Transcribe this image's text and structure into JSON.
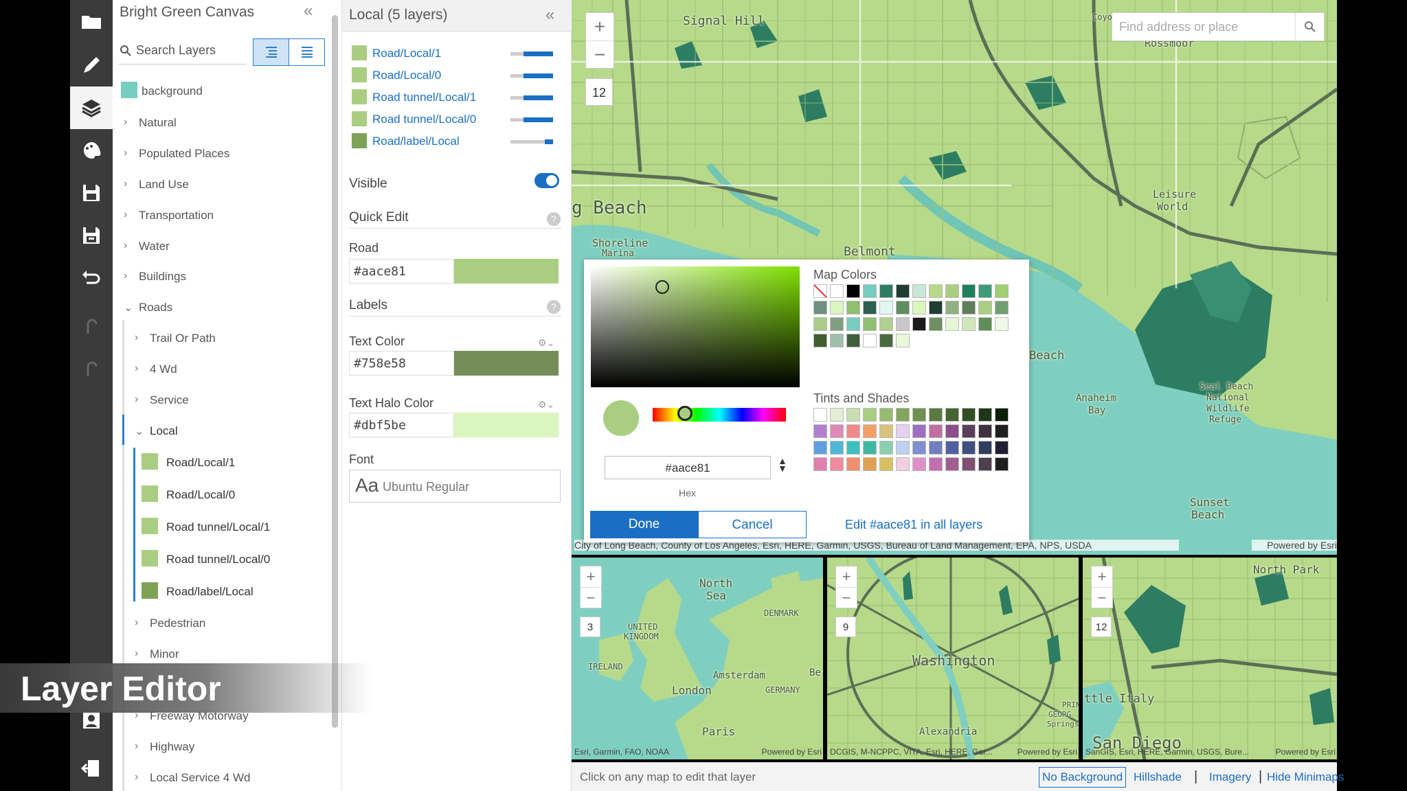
{
  "layers_panel": {
    "title": "Bright Green Canvas",
    "search_label": "Search Layers",
    "background_label": "background",
    "groups": [
      "Natural",
      "Populated Places",
      "Land Use",
      "Transportation",
      "Water",
      "Buildings",
      "Roads"
    ],
    "roads_children": [
      "Trail Or Path",
      "4 Wd",
      "Service",
      "Local"
    ],
    "local_children": [
      "Road/Local/1",
      "Road/Local/0",
      "Road tunnel/Local/1",
      "Road tunnel/Local/0",
      "Road/label/Local"
    ],
    "more_roads": [
      "Pedestrian",
      "Minor",
      "Freeway Motorway",
      "Highway",
      "Local Service 4 Wd"
    ]
  },
  "style_panel": {
    "title": "Local (5 layers)",
    "layers": [
      {
        "name": "Road/Local/1",
        "level": 0.7
      },
      {
        "name": "Road/Local/0",
        "level": 0.7
      },
      {
        "name": "Road tunnel/Local/1",
        "level": 0.7
      },
      {
        "name": "Road tunnel/Local/0",
        "level": 0.7
      },
      {
        "name": "Road/label/Local",
        "level": 0.2
      }
    ],
    "visible_label": "Visible",
    "quick_edit_label": "Quick Edit",
    "road_label": "Road",
    "road_color": "#aace81",
    "labels_label": "Labels",
    "text_color_label": "Text Color",
    "text_color": "#758e58",
    "text_halo_label": "Text Halo Color",
    "text_halo_color": "#dbf5be",
    "font_label": "Font",
    "font_sample": "Aa",
    "font_name": "Ubuntu Regular"
  },
  "map": {
    "search_placeholder": "Find address or place",
    "zoom_level": "12",
    "labels": [
      "Signal Hill",
      "g Beach",
      "Shoreline",
      "Marina",
      "Belmont",
      "Leisure",
      "World",
      "Beach",
      "Anaheim",
      "Bay",
      "Seal Beach",
      "National",
      "Wildlife",
      "Refuge",
      "Sunset",
      "Beach",
      "Rossmoor",
      "Coyo"
    ],
    "attribution": "City of Long Beach, County of Los Angeles, Esri, HERE, Garmin, USGS, Bureau of Land Management, EPA, NPS, USDA",
    "powered_by": "Powered by Esri"
  },
  "minimaps": [
    {
      "zoom": "3",
      "labels": [
        "North",
        "Sea",
        "UNITED",
        "KINGDOM",
        "IRELAND",
        "DENMARK",
        "Amsterdam",
        "Be",
        "GERMANY",
        "London",
        "Paris"
      ],
      "attribution": "Esri, Garmin, FAO, NOAA",
      "powered_by": "Powered by Esri"
    },
    {
      "zoom": "9",
      "labels": [
        "Washington",
        "Alexandria",
        "PRIN",
        "GEORG",
        "Springs"
      ],
      "attribution": "DCGIS, M-NCPPC, VITA, Esri, HERE, Gar...",
      "powered_by": "Powered by Esri"
    },
    {
      "zoom": "12",
      "labels": [
        "North Park",
        "ttle Italy",
        "San Diego"
      ],
      "attribution": "SanGIS, Esri, HERE, Garmin, USGS, Bure...",
      "powered_by": "Powered by Esri"
    }
  ],
  "bottom_bar": {
    "hint": "Click on any map to edit that layer",
    "links": [
      "No Background",
      "Hillshade",
      "Imagery",
      "Hide Minimaps"
    ]
  },
  "color_picker": {
    "hex_value": "#aace81",
    "hex_caption": "Hex",
    "done_label": "Done",
    "cancel_label": "Cancel",
    "edit_all_label": "Edit #aace81 in all layers",
    "map_colors_title": "Map Colors",
    "map_colors": [
      "none",
      "#ffffff",
      "#000000",
      "#77cdbf",
      "#2d7d63",
      "#1f3d33",
      "#c9e6d6",
      "#b6d98a",
      "#aace81",
      "#1f7f5f",
      "#3f9a78",
      "#9fcf72",
      "#6f8f7f",
      "#dbf5be",
      "#8fbf6f",
      "#2f5f4f",
      "#e0f8f4",
      "#5f8f5f",
      "#dbf5be",
      "#1f3f36",
      "#8fb080",
      "#5f7f5a",
      "#aace81",
      "#6f9f6f",
      "#aacc88",
      "#7f9f7f",
      "#77cdbf",
      "#8fbf70",
      "#b0cf90",
      "#c8c8c8",
      "#1a1a1a",
      "#6f8f60",
      "#e6f6d6",
      "#d0e8b8",
      "#5f8f58",
      "#f0f8e8",
      "#3f5f2f",
      "#9fbfa8",
      "#3f5f3a",
      "#ffffff",
      "#4a6a3f",
      "#e8f8d8"
    ],
    "tints_title": "Tints and Shades",
    "tints": [
      "#ffffff",
      "#e3eed6",
      "#c8ddb0",
      "#aace81",
      "#97bb6f",
      "#83a65f",
      "#6f9050",
      "#5b7a41",
      "#476433",
      "#334e25",
      "#1f3717",
      "#0b1f08",
      "#b07fd0",
      "#e08ab8",
      "#f28a8a",
      "#f2a06a",
      "#d9c27a",
      "#e4d0f0",
      "#9e6fc0",
      "#c06fa0",
      "#8a4f8a",
      "#5a3f5a",
      "#3f2f3f",
      "#1f1f1f",
      "#5f9fe0",
      "#4fb8d8",
      "#3fc0c0",
      "#3fb8a0",
      "#8ad0b0",
      "#c0d0f0",
      "#7f8fd0",
      "#6f7fc0",
      "#4f5f9f",
      "#3f4f7f",
      "#2f3f5f",
      "#1f1f2f",
      "#e07fb0",
      "#f08aa0",
      "#f08f70",
      "#e0a050",
      "#d8c060",
      "#f0d0e0",
      "#e090c8",
      "#c070b0",
      "#a05f90",
      "#7f4f6f",
      "#4f3f4f",
      "#1f1f1f"
    ]
  },
  "caption": "Layer Editor"
}
